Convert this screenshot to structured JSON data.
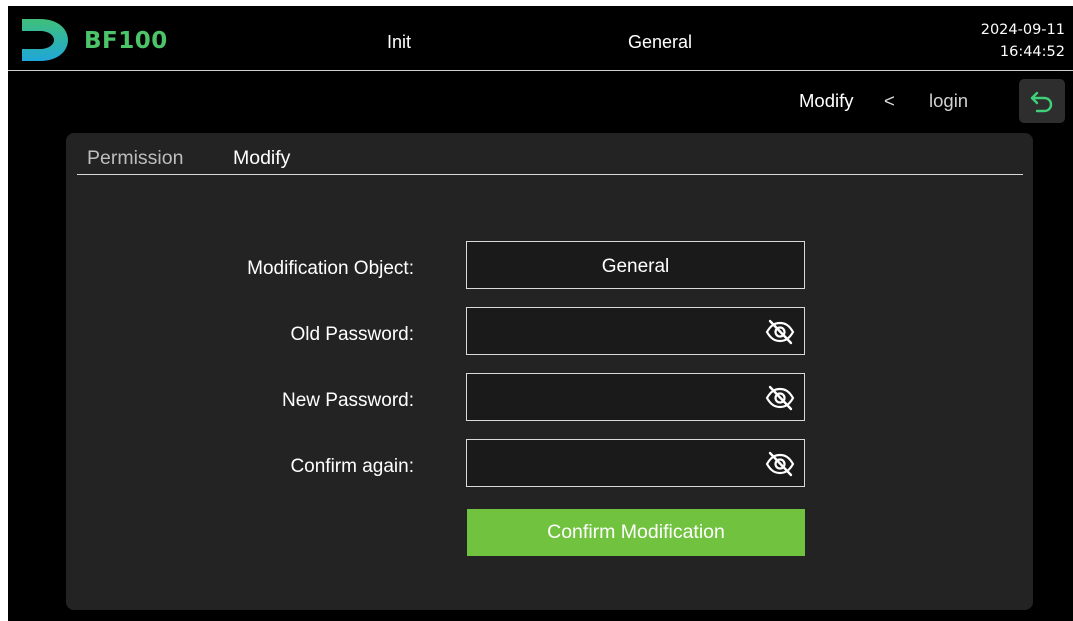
{
  "header": {
    "brand": "BF100",
    "menu": {
      "init": "Init",
      "general": "General"
    },
    "date": "2024-09-11",
    "time": "16:44:52",
    "logo_icon": "d-logo-icon",
    "colors": {
      "brand_green": "#4cc46a",
      "logo_blue": "#1fa7d9"
    }
  },
  "breadcrumb": {
    "current": "Modify",
    "separator": "<",
    "parent": "login",
    "back_icon": "undo-arrow-icon"
  },
  "tabs": [
    {
      "label": "Permission",
      "active": false
    },
    {
      "label": "Modify",
      "active": true
    }
  ],
  "form": {
    "object_label": "Modification Object:",
    "object_value": "General",
    "old_label": "Old Password:",
    "new_label": "New Password:",
    "confirm_label": "Confirm again:",
    "old_value": "",
    "new_value": "",
    "confirm_value": "",
    "eye_icon": "eye-slash-icon",
    "submit_label": "Confirm Modification",
    "submit_color": "#71c33f"
  }
}
